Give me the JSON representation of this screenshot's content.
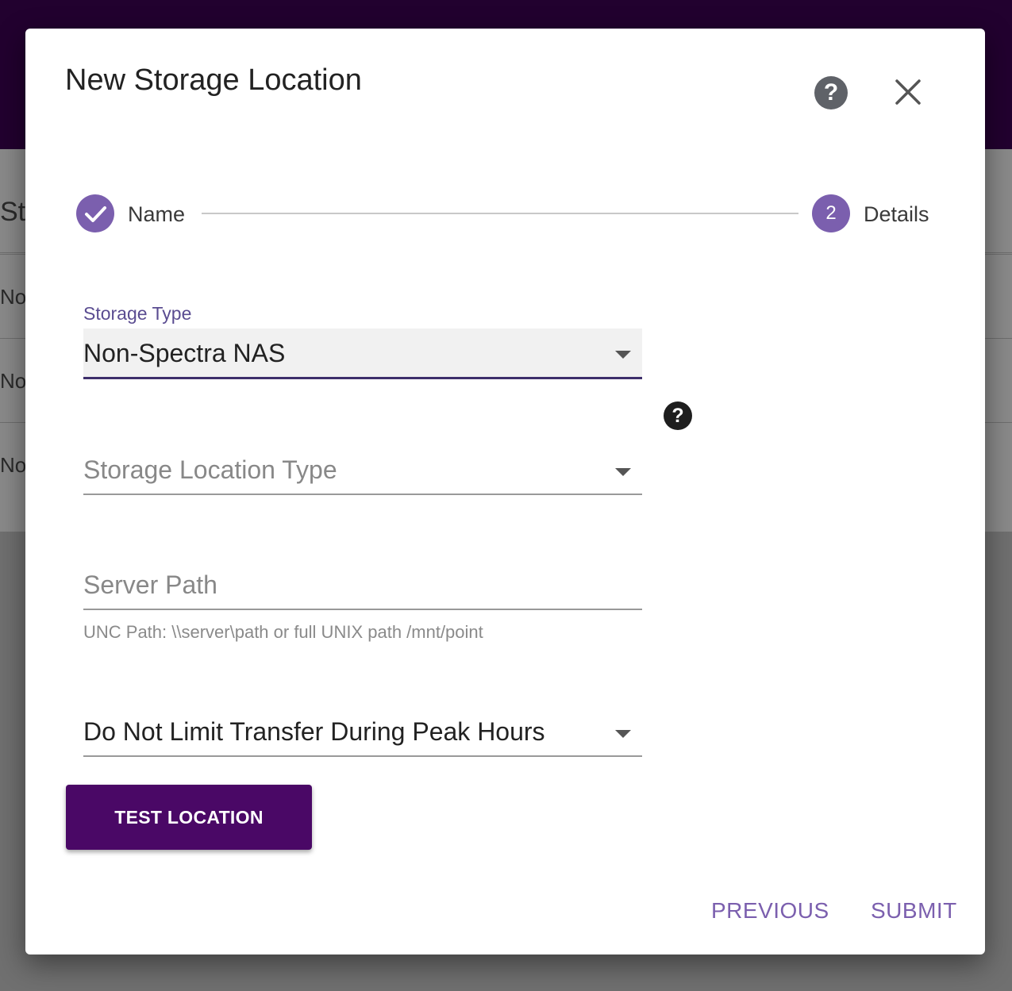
{
  "background": {
    "title_fragment": "St",
    "rows": [
      "No",
      "No",
      "No"
    ]
  },
  "dialog": {
    "title": "New Storage Location",
    "help_icon": "?",
    "close_icon": "close-icon"
  },
  "stepper": {
    "steps": [
      {
        "label": "Name",
        "state": "completed"
      },
      {
        "label": "Details",
        "number": "2",
        "state": "active"
      }
    ]
  },
  "form": {
    "storage_type": {
      "label": "Storage Type",
      "value": "Non-Spectra NAS"
    },
    "info_icon": "?",
    "storage_location_type": {
      "placeholder": "Storage Location Type"
    },
    "server_path": {
      "placeholder": "Server Path",
      "value": "",
      "hint": "UNC Path: \\\\server\\path or full UNIX path /mnt/point"
    },
    "peak_hours": {
      "value": "Do Not Limit Transfer During Peak Hours"
    }
  },
  "buttons": {
    "test_location": "TEST LOCATION",
    "previous": "PREVIOUS",
    "submit": "SUBMIT"
  },
  "colors": {
    "accent": "#7b5fae",
    "primary_button": "#4a0866",
    "header_bg": "#22012f"
  }
}
